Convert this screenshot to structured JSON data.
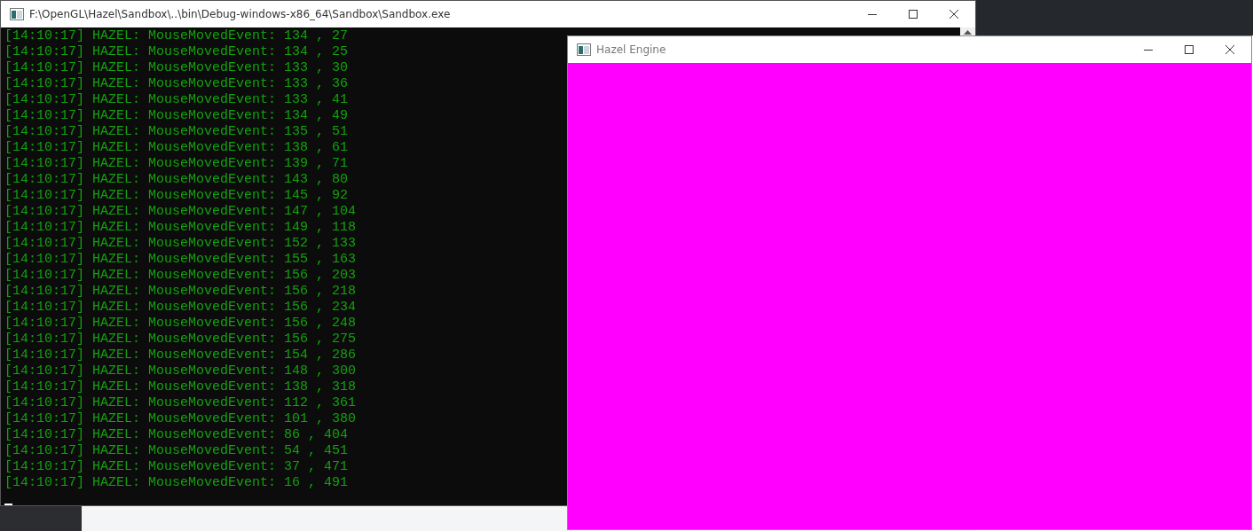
{
  "console_window": {
    "title": "F:\\OpenGL\\Hazel\\Sandbox\\..\\bin\\Debug-windows-x86_64\\Sandbox\\Sandbox.exe",
    "lines": [
      "[14:10:17] HAZEL: MouseMovedEvent: 134 , 27",
      "[14:10:17] HAZEL: MouseMovedEvent: 134 , 25",
      "[14:10:17] HAZEL: MouseMovedEvent: 133 , 30",
      "[14:10:17] HAZEL: MouseMovedEvent: 133 , 36",
      "[14:10:17] HAZEL: MouseMovedEvent: 133 , 41",
      "[14:10:17] HAZEL: MouseMovedEvent: 134 , 49",
      "[14:10:17] HAZEL: MouseMovedEvent: 135 , 51",
      "[14:10:17] HAZEL: MouseMovedEvent: 138 , 61",
      "[14:10:17] HAZEL: MouseMovedEvent: 139 , 71",
      "[14:10:17] HAZEL: MouseMovedEvent: 143 , 80",
      "[14:10:17] HAZEL: MouseMovedEvent: 145 , 92",
      "[14:10:17] HAZEL: MouseMovedEvent: 147 , 104",
      "[14:10:17] HAZEL: MouseMovedEvent: 149 , 118",
      "[14:10:17] HAZEL: MouseMovedEvent: 152 , 133",
      "[14:10:17] HAZEL: MouseMovedEvent: 155 , 163",
      "[14:10:17] HAZEL: MouseMovedEvent: 156 , 203",
      "[14:10:17] HAZEL: MouseMovedEvent: 156 , 218",
      "[14:10:17] HAZEL: MouseMovedEvent: 156 , 234",
      "[14:10:17] HAZEL: MouseMovedEvent: 156 , 248",
      "[14:10:17] HAZEL: MouseMovedEvent: 156 , 275",
      "[14:10:17] HAZEL: MouseMovedEvent: 154 , 286",
      "[14:10:17] HAZEL: MouseMovedEvent: 148 , 300",
      "[14:10:17] HAZEL: MouseMovedEvent: 138 , 318",
      "[14:10:17] HAZEL: MouseMovedEvent: 112 , 361",
      "[14:10:17] HAZEL: MouseMovedEvent: 101 , 380",
      "[14:10:17] HAZEL: MouseMovedEvent: 86 , 404",
      "[14:10:17] HAZEL: MouseMovedEvent: 54 , 451",
      "[14:10:17] HAZEL: MouseMovedEvent: 37 , 471",
      "[14:10:17] HAZEL: MouseMovedEvent: 16 , 491"
    ]
  },
  "engine_window": {
    "title": "Hazel Engine"
  }
}
